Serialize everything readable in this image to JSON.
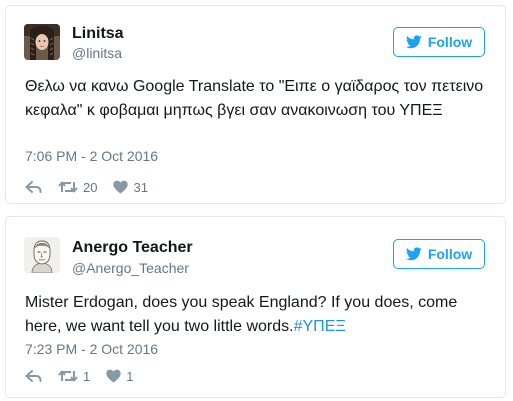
{
  "tweets": [
    {
      "name": "Linitsa",
      "handle": "@linitsa",
      "follow_label": "Follow",
      "text": "Θελω να κανω Google Translate το \"Ειπε ο γαϊδαρος τον πετεινο κεφαλα\" κ φοβαμαι μηπως βγει σαν ανακοινωση του ΥΠΕΞ",
      "timestamp": "7:06 PM - 2 Oct 2016",
      "retweets": "20",
      "likes": "31",
      "avatar_icon": "woman-braids-avatar"
    },
    {
      "name": "Anergo Teacher",
      "handle": "@Anergo_Teacher",
      "follow_label": "Follow",
      "text": "Mister Erdogan, does you speak England? If you does, come here, we want tell you two little words.",
      "hashtag": "#ΥΠΕΞ",
      "timestamp": "7:23 PM - 2 Oct 2016",
      "retweets": "1",
      "likes": "1",
      "avatar_icon": "sketch-man-avatar"
    }
  ],
  "colors": {
    "accent": "#1da1f2",
    "hashtag": "#1b95e0",
    "muted": "#657786",
    "border": "#e1e8ed"
  },
  "icons": {
    "follow": "twitter-bird-icon",
    "reply": "reply-icon",
    "retweet": "retweet-icon",
    "like": "heart-icon"
  }
}
